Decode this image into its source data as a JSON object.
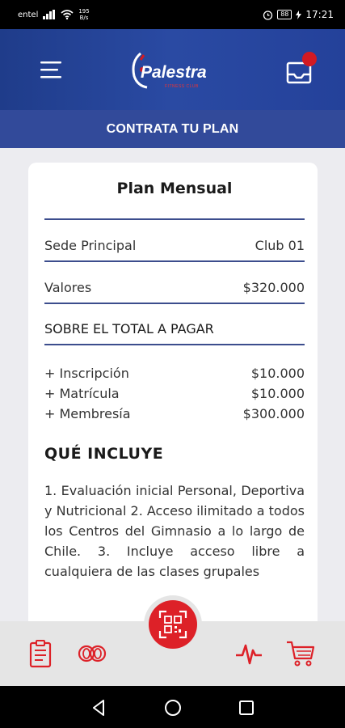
{
  "status_bar": {
    "carrier": "entel",
    "speed_value": "195",
    "speed_unit": "B/s",
    "battery": "88",
    "time": "17:21"
  },
  "header": {
    "logo_text": "Palestra",
    "logo_tagline": "FITNESS CLUB"
  },
  "subheader": {
    "title": "CONTRATA TU PLAN"
  },
  "plan": {
    "title": "Plan Mensual",
    "sede_label": "Sede Principal",
    "sede_value": "Club 01",
    "valores_label": "Valores",
    "valores_value": "$320.000",
    "total_heading": "SOBRE EL TOTAL A PAGAR",
    "items": [
      {
        "label": "+ Inscripción",
        "value": "$10.000"
      },
      {
        "label": "+ Matrícula",
        "value": "$10.000"
      },
      {
        "label": "+ Membresía",
        "value": "$300.000"
      }
    ],
    "includes_title": "QUÉ INCLUYE",
    "includes_text": "1. Evaluación inicial Personal, Deportiva y Nutricional 2. Acceso ilimitado a todos los Centros del Gimnasio a lo largo de Chile. 3. Incluye acceso libre a cualquiera de las clases grupales"
  },
  "colors": {
    "primary_blue": "#2a4aa3",
    "accent_red": "#dd2128",
    "divider": "#3c4d8d"
  },
  "bottom_nav": {
    "icons": [
      "clipboard-icon",
      "rings-icon",
      "qr-code-icon",
      "heartbeat-icon",
      "cart-icon"
    ]
  }
}
